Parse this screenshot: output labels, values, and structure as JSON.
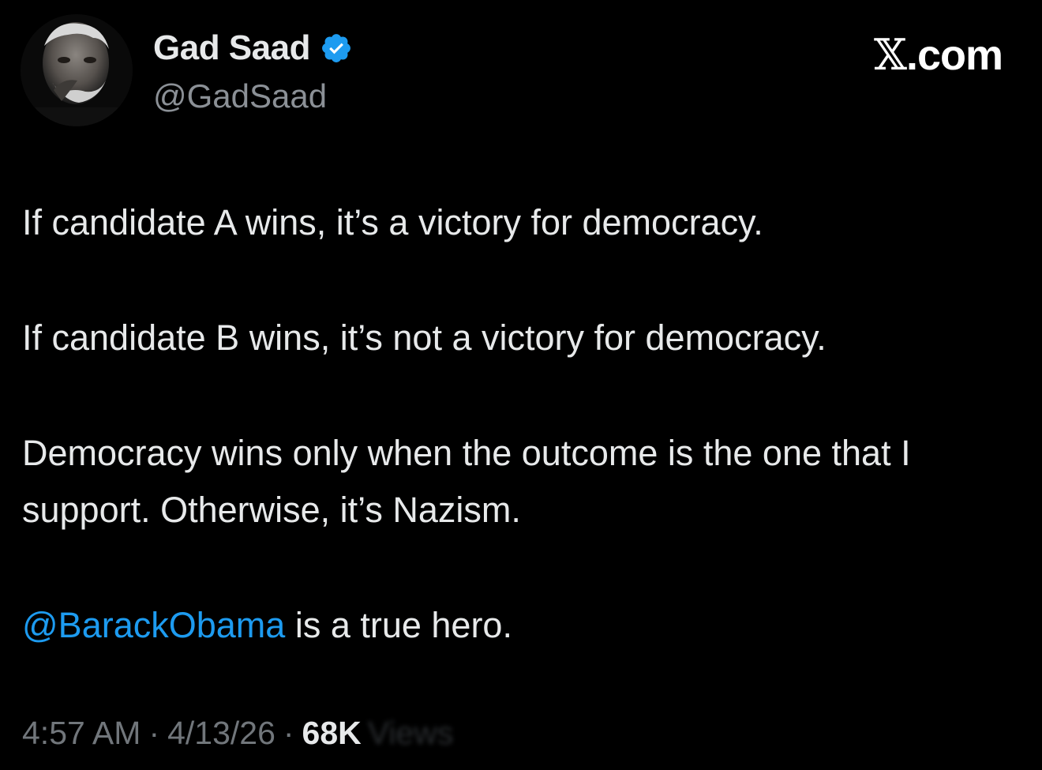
{
  "author": {
    "display_name": "Gad Saad",
    "handle": "@GadSaad",
    "verified_icon": "verified-badge-icon",
    "avatar_icon": "profile-avatar"
  },
  "brand": {
    "label": "𝕏.com",
    "x_mark": "𝕏",
    "domain": ".com"
  },
  "tweet": {
    "paragraphs": [
      "If candidate A wins, it’s a victory for democracy.",
      "If candidate B wins, it’s not a victory for democracy.",
      "Democracy wins only when the outcome is the one that I support. Otherwise, it’s Nazism."
    ],
    "closing": {
      "mention": "@BarackObama",
      "text": " is a true hero."
    }
  },
  "meta": {
    "time": "4:57 AM",
    "separator": "·",
    "date": "4/13/26",
    "views_count": "68K",
    "views_label": "Views"
  },
  "colors": {
    "background": "#000000",
    "primary_text": "#e7e9ea",
    "secondary_text": "#71767b",
    "mention": "#1d9bf0",
    "verified": "#1d9bf0"
  }
}
